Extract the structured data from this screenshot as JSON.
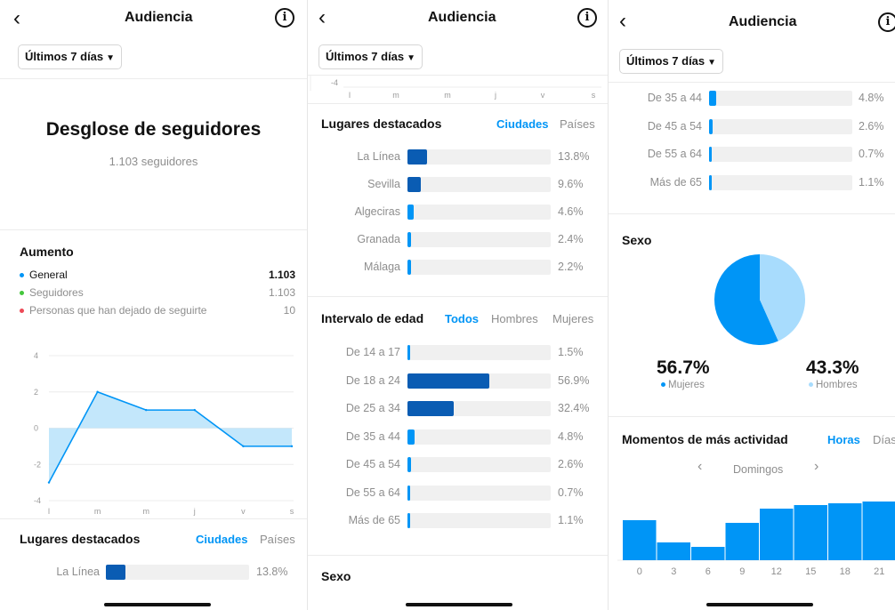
{
  "header": {
    "title": "Audiencia",
    "back_icon": "chevron-left-icon",
    "info_icon": "info-icon"
  },
  "filter": {
    "label": "Últimos 7 días"
  },
  "colors": {
    "accent": "#0095f6",
    "dark_bar": "#0a5cb3",
    "pie_light": "#a8dcfd",
    "area": "#b9e3fa",
    "general": "#0095f6",
    "seguidores": "#44c63c",
    "dejado": "#ed4956"
  },
  "breakdown": {
    "title": "Desglose de seguidores",
    "subtitle": "1.103 seguidores"
  },
  "growth": {
    "title": "Aumento",
    "rows": [
      {
        "label": "General",
        "value": "1.103"
      },
      {
        "label": "Seguidores",
        "value": "1.103"
      },
      {
        "label": "Personas que han dejado de seguirte",
        "value": "10"
      }
    ]
  },
  "chart_data": {
    "type": "line",
    "x": [
      "l",
      "m",
      "m",
      "j",
      "v",
      "s"
    ],
    "values": [
      -3,
      2,
      1,
      1,
      -1,
      -1
    ],
    "yticks": [
      "4",
      "2",
      "0",
      "-2",
      "-4"
    ],
    "ylim": [
      -4,
      4
    ]
  },
  "places": {
    "title": "Lugares destacados",
    "tab_active": "Ciudades",
    "tab_inactive": "Países",
    "rows": [
      {
        "label": "La Línea",
        "value": "13.8%",
        "pct": 13.8
      },
      {
        "label": "Sevilla",
        "value": "9.6%",
        "pct": 9.6
      },
      {
        "label": "Algeciras",
        "value": "4.6%",
        "pct": 4.6
      },
      {
        "label": "Granada",
        "value": "2.4%",
        "pct": 2.4
      },
      {
        "label": "Málaga",
        "value": "2.2%",
        "pct": 2.2
      }
    ]
  },
  "age": {
    "title": "Intervalo de edad",
    "tabs": [
      "Todos",
      "Hombres",
      "Mujeres"
    ],
    "rows": [
      {
        "label": "De 14 a 17",
        "value": "1.5%",
        "pct": 1.5
      },
      {
        "label": "De 18 a 24",
        "value": "56.9%",
        "pct": 56.9
      },
      {
        "label": "De 25 a 34",
        "value": "32.4%",
        "pct": 32.4
      },
      {
        "label": "De 35 a 44",
        "value": "4.8%",
        "pct": 4.8
      },
      {
        "label": "De 45 a 54",
        "value": "2.6%",
        "pct": 2.6
      },
      {
        "label": "De 55 a 64",
        "value": "0.7%",
        "pct": 0.7
      },
      {
        "label": "Más de 65",
        "value": "1.1%",
        "pct": 1.1
      }
    ]
  },
  "gender": {
    "title": "Sexo",
    "women": {
      "value": "56.7%",
      "label": "Mujeres",
      "pct": 56.7
    },
    "men": {
      "value": "43.3%",
      "label": "Hombres",
      "pct": 43.3
    }
  },
  "activity": {
    "title": "Momentos de más actividad",
    "tab_active": "Horas",
    "tab_inactive": "Días",
    "day": "Domingos",
    "prev_icon": "chevron-left-icon",
    "next_icon": "chevron-right-icon",
    "x_labels": [
      "0",
      "3",
      "6",
      "9",
      "12",
      "15",
      "18",
      "21"
    ],
    "bars": [
      45,
      20,
      15,
      42,
      58,
      62,
      64,
      66
    ]
  }
}
